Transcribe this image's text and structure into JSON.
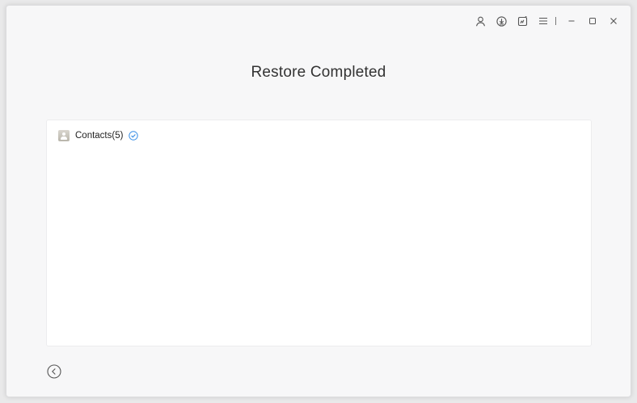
{
  "window": {
    "title_bar": {
      "icons": [
        "user-icon",
        "download-icon",
        "feedback-icon",
        "menu-icon",
        "minimize-icon",
        "maximize-icon",
        "close-icon"
      ]
    }
  },
  "main": {
    "title": "Restore Completed",
    "items": [
      {
        "label": "Contacts(5)",
        "icon": "contacts-icon",
        "status_icon": "check-circle-icon"
      }
    ],
    "back_icon": "back-arrow-icon"
  },
  "colors": {
    "background": "#f7f7f8",
    "panel": "#ffffff",
    "check": "#3a8fe6",
    "text": "#333333"
  }
}
